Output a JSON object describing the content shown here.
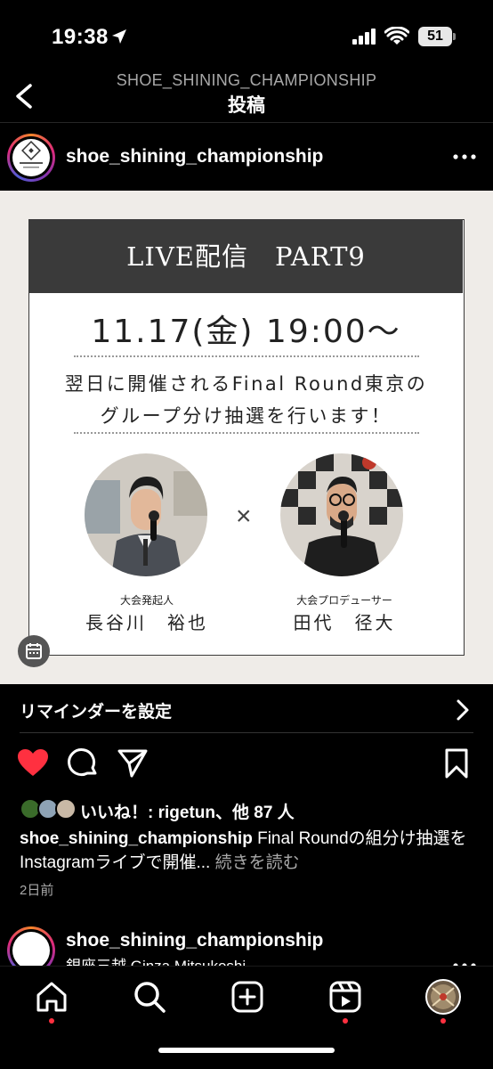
{
  "status_bar": {
    "time": "19:38",
    "battery": "51"
  },
  "header": {
    "account": "SHOE_SHINING_CHAMPIONSHIP",
    "title": "投稿"
  },
  "post": {
    "username": "shoe_shining_championship",
    "image": {
      "heading": "LIVE配信　PART9",
      "date": "11.17(金) 19:00〜",
      "desc_line1": "翌日に開催されるFinal Round東京の",
      "desc_line2": "グループ分け抽選を行います！",
      "times_symbol": "×",
      "person1_role": "大会発起人",
      "person1_name": "長谷川　裕也",
      "person2_role": "大会プロデューサー",
      "person2_name": "田代　径大"
    },
    "reminder_label": "リマインダーを設定",
    "likes_text": "いいね！: rigetun、他 87 人",
    "caption_user": "shoe_shining_championship",
    "caption_text": " Final Roundの組分け抽選をInstagramライブで開催... ",
    "caption_more": "続きを読む",
    "time_ago": "2日前"
  },
  "next_post": {
    "username": "shoe_shining_championship",
    "location": "銀座三越 Ginza Mitsukoshi"
  },
  "colors": {
    "like_red": "#ff3040",
    "background": "#000000",
    "card_header": "#3a3a3a"
  }
}
